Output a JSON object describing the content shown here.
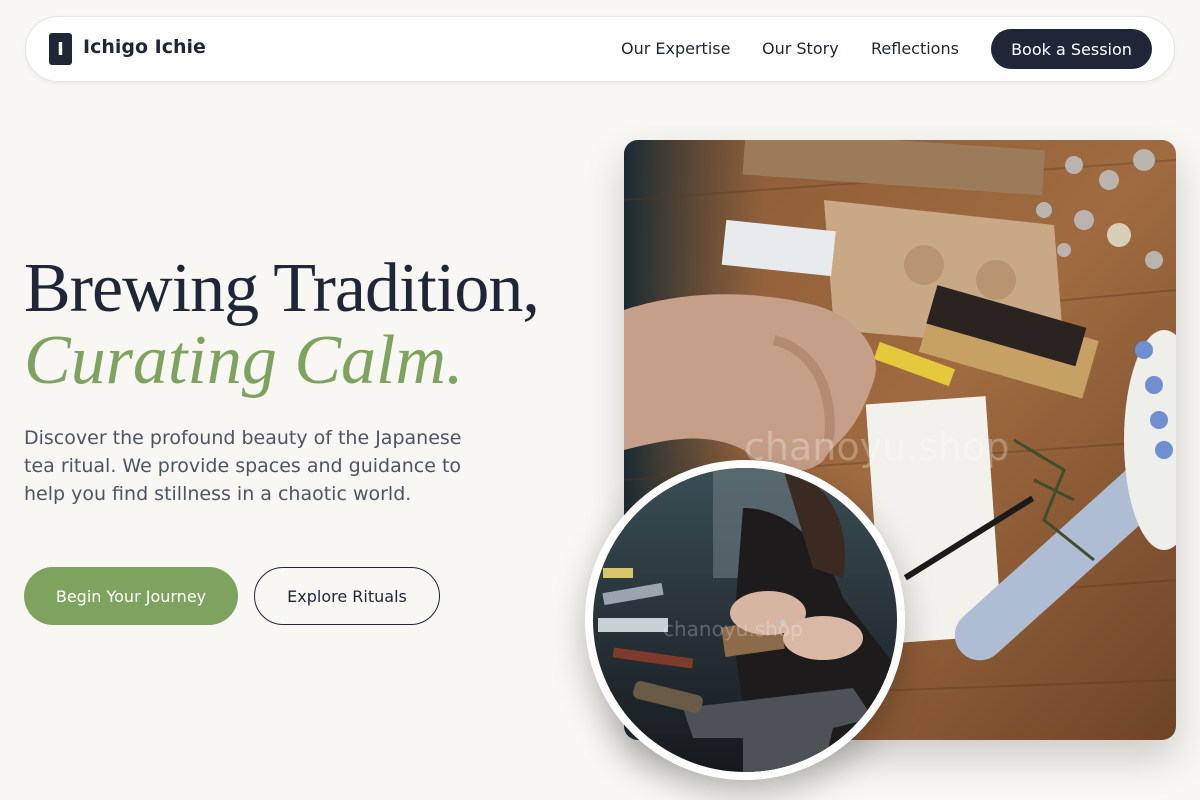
{
  "brand": {
    "mark": "I",
    "name": "Ichigo Ichie"
  },
  "nav": {
    "links": [
      "Our Expertise",
      "Our Story",
      "Reflections"
    ],
    "cta": "Book a Session"
  },
  "hero": {
    "title_line1": "Brewing Tradition,",
    "title_line2": "Curating Calm.",
    "description": "Discover the profound beauty of the Japanese tea ritual. We provide spaces and guidance to help you find stillness in a chaotic world.",
    "primary_button": "Begin Your Journey",
    "secondary_button": "Explore Rituals"
  },
  "images": {
    "main": {
      "description": "Hands working at a craft workbench with tools, paper and wax seals",
      "watermark": "chanoyu.shop"
    },
    "inset": {
      "description": "Craftsperson hammering metal on an anvil",
      "watermark": "chanoyu.shop"
    }
  },
  "colors": {
    "background": "#f8f7f3",
    "navy": "#1e2638",
    "sage": "#7ea35f",
    "muted_text": "#4d5463"
  }
}
